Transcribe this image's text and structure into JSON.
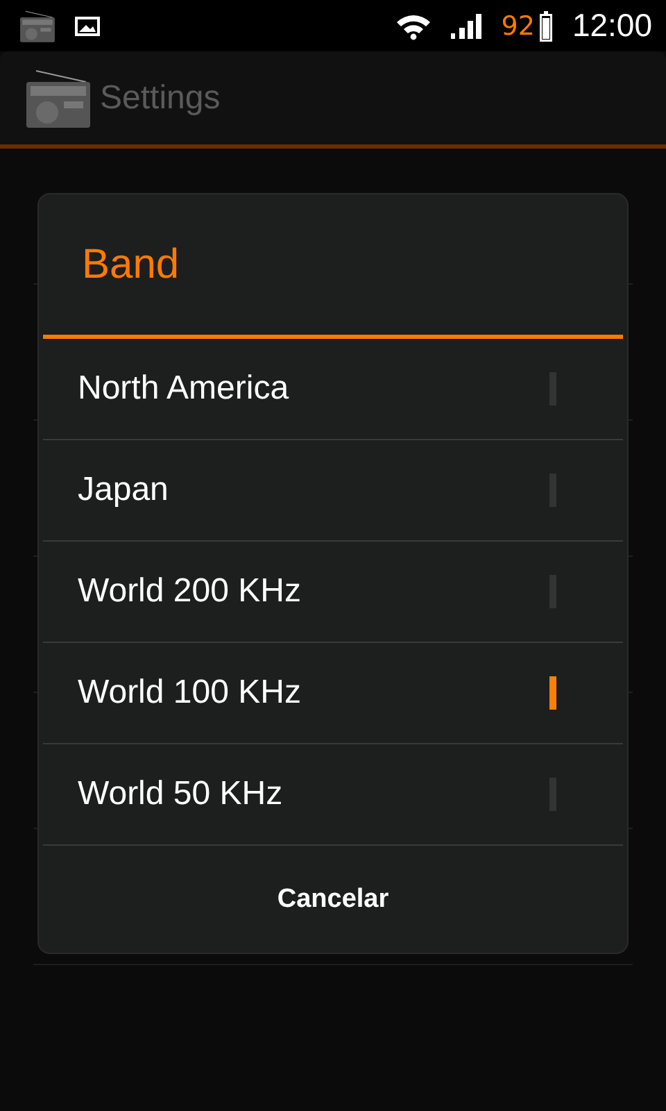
{
  "status_bar": {
    "battery_text": "92",
    "time": "12:00"
  },
  "action_bar": {
    "title": "Settings"
  },
  "dialog": {
    "title": "Band",
    "options": [
      {
        "label": "North America",
        "selected": false
      },
      {
        "label": "Japan",
        "selected": false
      },
      {
        "label": "World 200 KHz",
        "selected": false
      },
      {
        "label": "World 100 KHz",
        "selected": true
      },
      {
        "label": "World 50 KHz",
        "selected": false
      }
    ],
    "button": "Cancelar"
  }
}
